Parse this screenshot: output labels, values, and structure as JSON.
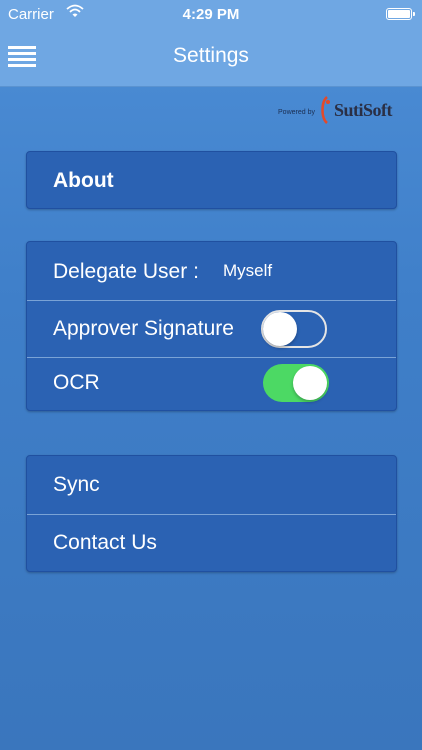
{
  "status_bar": {
    "carrier": "Carrier",
    "time": "4:29 PM"
  },
  "nav": {
    "title": "Settings",
    "menu_icon": "hamburger-menu-icon"
  },
  "branding": {
    "powered_by": "Powered by",
    "logo": "SutiSoft"
  },
  "sections": {
    "about": {
      "label": "About"
    },
    "preferences": {
      "delegate_label": "Delegate User :",
      "delegate_value": "Myself",
      "approver_signature_label": "Approver Signature",
      "approver_signature_on": false,
      "ocr_label": "OCR",
      "ocr_on": true
    },
    "support": {
      "sync_label": "Sync",
      "contact_label": "Contact Us"
    }
  },
  "colors": {
    "nav_bg": "#6fa7e3",
    "card_bg": "#2b62b3",
    "toggle_on": "#4cd964",
    "logo_accent": "#e34a2a"
  }
}
